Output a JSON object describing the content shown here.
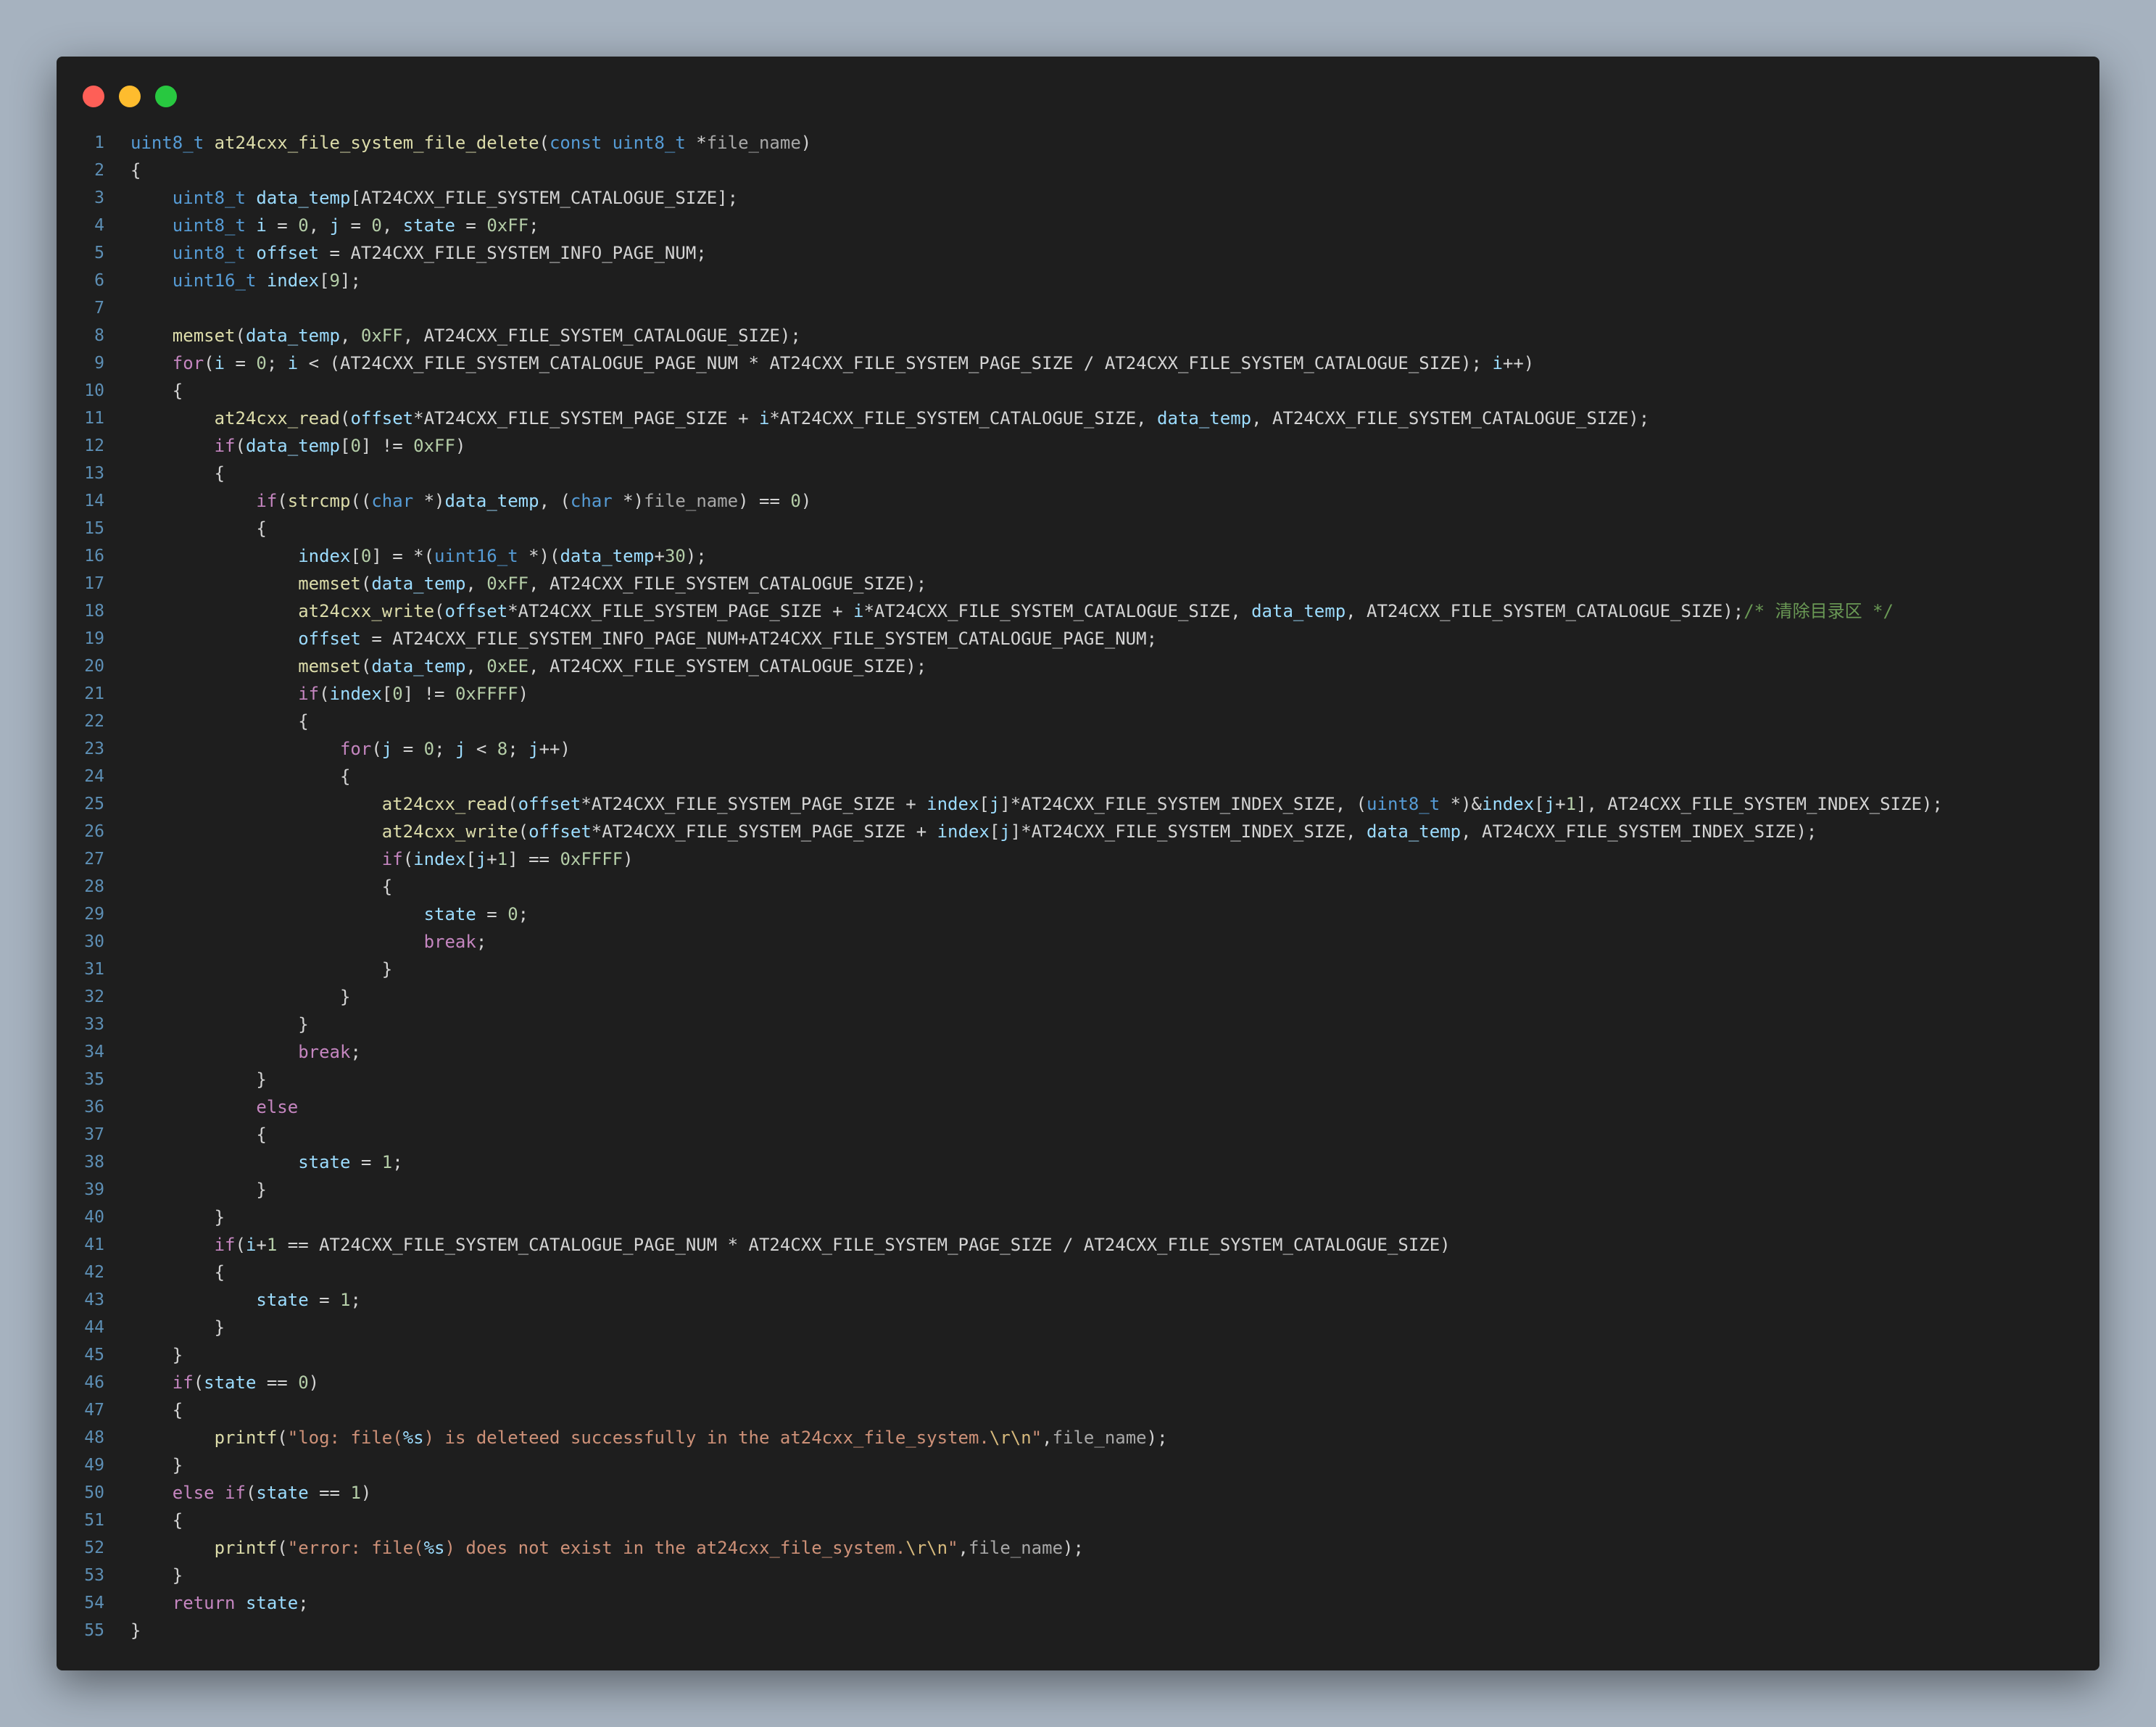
{
  "window": {
    "traffic_lights": [
      {
        "name": "close-button",
        "color": "#fe5f57"
      },
      {
        "name": "minimize-button",
        "color": "#febc2e"
      },
      {
        "name": "maximize-button",
        "color": "#28c840"
      }
    ]
  },
  "code": {
    "language": "c",
    "lines": [
      [
        [
          "type",
          "uint8_t "
        ],
        [
          "fn",
          "at24cxx_file_system_file_delete"
        ],
        [
          "p",
          "("
        ],
        [
          "type",
          "const uint8_t "
        ],
        [
          "p",
          "*"
        ],
        [
          "par",
          "file_name"
        ],
        [
          "p",
          ")"
        ]
      ],
      [
        [
          "p",
          "{"
        ]
      ],
      [
        [
          "p",
          "    "
        ],
        [
          "type",
          "uint8_t "
        ],
        [
          "var",
          "data_temp"
        ],
        [
          "p",
          "[AT24CXX_FILE_SYSTEM_CATALOGUE_SIZE];"
        ]
      ],
      [
        [
          "p",
          "    "
        ],
        [
          "type",
          "uint8_t "
        ],
        [
          "var",
          "i"
        ],
        [
          "p",
          " = "
        ],
        [
          "num",
          "0"
        ],
        [
          "p",
          ", "
        ],
        [
          "var",
          "j"
        ],
        [
          "p",
          " = "
        ],
        [
          "num",
          "0"
        ],
        [
          "p",
          ", "
        ],
        [
          "var",
          "state"
        ],
        [
          "p",
          " = "
        ],
        [
          "num",
          "0xFF"
        ],
        [
          "p",
          ";"
        ]
      ],
      [
        [
          "p",
          "    "
        ],
        [
          "type",
          "uint8_t "
        ],
        [
          "var",
          "offset"
        ],
        [
          "p",
          " = AT24CXX_FILE_SYSTEM_INFO_PAGE_NUM;"
        ]
      ],
      [
        [
          "p",
          "    "
        ],
        [
          "type",
          "uint16_t "
        ],
        [
          "var",
          "index"
        ],
        [
          "p",
          "["
        ],
        [
          "num",
          "9"
        ],
        [
          "p",
          "];"
        ]
      ],
      [],
      [
        [
          "p",
          "    "
        ],
        [
          "fn",
          "memset"
        ],
        [
          "p",
          "("
        ],
        [
          "var",
          "data_temp"
        ],
        [
          "p",
          ", "
        ],
        [
          "num",
          "0xFF"
        ],
        [
          "p",
          ", AT24CXX_FILE_SYSTEM_CATALOGUE_SIZE);"
        ]
      ],
      [
        [
          "p",
          "    "
        ],
        [
          "kw",
          "for"
        ],
        [
          "p",
          "("
        ],
        [
          "var",
          "i"
        ],
        [
          "p",
          " = "
        ],
        [
          "num",
          "0"
        ],
        [
          "p",
          "; "
        ],
        [
          "var",
          "i"
        ],
        [
          "p",
          " < (AT24CXX_FILE_SYSTEM_CATALOGUE_PAGE_NUM * AT24CXX_FILE_SYSTEM_PAGE_SIZE / AT24CXX_FILE_SYSTEM_CATALOGUE_SIZE); "
        ],
        [
          "var",
          "i"
        ],
        [
          "p",
          "++)"
        ]
      ],
      [
        [
          "p",
          "    {"
        ]
      ],
      [
        [
          "p",
          "        "
        ],
        [
          "fn",
          "at24cxx_read"
        ],
        [
          "p",
          "("
        ],
        [
          "var",
          "offset"
        ],
        [
          "p",
          "*AT24CXX_FILE_SYSTEM_PAGE_SIZE + "
        ],
        [
          "var",
          "i"
        ],
        [
          "p",
          "*AT24CXX_FILE_SYSTEM_CATALOGUE_SIZE, "
        ],
        [
          "var",
          "data_temp"
        ],
        [
          "p",
          ", AT24CXX_FILE_SYSTEM_CATALOGUE_SIZE);"
        ]
      ],
      [
        [
          "p",
          "        "
        ],
        [
          "kw",
          "if"
        ],
        [
          "p",
          "("
        ],
        [
          "var",
          "data_temp"
        ],
        [
          "p",
          "["
        ],
        [
          "num",
          "0"
        ],
        [
          "p",
          "] != "
        ],
        [
          "num",
          "0xFF"
        ],
        [
          "p",
          ")"
        ]
      ],
      [
        [
          "p",
          "        {"
        ]
      ],
      [
        [
          "p",
          "            "
        ],
        [
          "kw",
          "if"
        ],
        [
          "p",
          "("
        ],
        [
          "fn",
          "strcmp"
        ],
        [
          "p",
          "(("
        ],
        [
          "type",
          "char "
        ],
        [
          "p",
          "*)"
        ],
        [
          "var",
          "data_temp"
        ],
        [
          "p",
          ", ("
        ],
        [
          "type",
          "char "
        ],
        [
          "p",
          "*)"
        ],
        [
          "par",
          "file_name"
        ],
        [
          "p",
          ") == "
        ],
        [
          "num",
          "0"
        ],
        [
          "p",
          ")"
        ]
      ],
      [
        [
          "p",
          "            {"
        ]
      ],
      [
        [
          "p",
          "                "
        ],
        [
          "var",
          "index"
        ],
        [
          "p",
          "["
        ],
        [
          "num",
          "0"
        ],
        [
          "p",
          "] = *("
        ],
        [
          "type",
          "uint16_t "
        ],
        [
          "p",
          "*)("
        ],
        [
          "var",
          "data_temp"
        ],
        [
          "p",
          "+"
        ],
        [
          "num",
          "30"
        ],
        [
          "p",
          ");"
        ]
      ],
      [
        [
          "p",
          "                "
        ],
        [
          "fn",
          "memset"
        ],
        [
          "p",
          "("
        ],
        [
          "var",
          "data_temp"
        ],
        [
          "p",
          ", "
        ],
        [
          "num",
          "0xFF"
        ],
        [
          "p",
          ", AT24CXX_FILE_SYSTEM_CATALOGUE_SIZE);"
        ]
      ],
      [
        [
          "p",
          "                "
        ],
        [
          "fn",
          "at24cxx_write"
        ],
        [
          "p",
          "("
        ],
        [
          "var",
          "offset"
        ],
        [
          "p",
          "*AT24CXX_FILE_SYSTEM_PAGE_SIZE + "
        ],
        [
          "var",
          "i"
        ],
        [
          "p",
          "*AT24CXX_FILE_SYSTEM_CATALOGUE_SIZE, "
        ],
        [
          "var",
          "data_temp"
        ],
        [
          "p",
          ", AT24CXX_FILE_SYSTEM_CATALOGUE_SIZE);"
        ],
        [
          "com",
          "/* 清除目录区 */"
        ]
      ],
      [
        [
          "p",
          "                "
        ],
        [
          "var",
          "offset"
        ],
        [
          "p",
          " = AT24CXX_FILE_SYSTEM_INFO_PAGE_NUM+AT24CXX_FILE_SYSTEM_CATALOGUE_PAGE_NUM;"
        ]
      ],
      [
        [
          "p",
          "                "
        ],
        [
          "fn",
          "memset"
        ],
        [
          "p",
          "("
        ],
        [
          "var",
          "data_temp"
        ],
        [
          "p",
          ", "
        ],
        [
          "num",
          "0xEE"
        ],
        [
          "p",
          ", AT24CXX_FILE_SYSTEM_CATALOGUE_SIZE);"
        ]
      ],
      [
        [
          "p",
          "                "
        ],
        [
          "kw",
          "if"
        ],
        [
          "p",
          "("
        ],
        [
          "var",
          "index"
        ],
        [
          "p",
          "["
        ],
        [
          "num",
          "0"
        ],
        [
          "p",
          "] != "
        ],
        [
          "num",
          "0xFFFF"
        ],
        [
          "p",
          ")"
        ]
      ],
      [
        [
          "p",
          "                {"
        ]
      ],
      [
        [
          "p",
          "                    "
        ],
        [
          "kw",
          "for"
        ],
        [
          "p",
          "("
        ],
        [
          "var",
          "j"
        ],
        [
          "p",
          " = "
        ],
        [
          "num",
          "0"
        ],
        [
          "p",
          "; "
        ],
        [
          "var",
          "j"
        ],
        [
          "p",
          " < "
        ],
        [
          "num",
          "8"
        ],
        [
          "p",
          "; "
        ],
        [
          "var",
          "j"
        ],
        [
          "p",
          "++)"
        ]
      ],
      [
        [
          "p",
          "                    {"
        ]
      ],
      [
        [
          "p",
          "                        "
        ],
        [
          "fn",
          "at24cxx_read"
        ],
        [
          "p",
          "("
        ],
        [
          "var",
          "offset"
        ],
        [
          "p",
          "*AT24CXX_FILE_SYSTEM_PAGE_SIZE + "
        ],
        [
          "var",
          "index"
        ],
        [
          "p",
          "["
        ],
        [
          "var",
          "j"
        ],
        [
          "p",
          "]*AT24CXX_FILE_SYSTEM_INDEX_SIZE, ("
        ],
        [
          "type",
          "uint8_t "
        ],
        [
          "p",
          "*)&"
        ],
        [
          "var",
          "index"
        ],
        [
          "p",
          "["
        ],
        [
          "var",
          "j"
        ],
        [
          "p",
          "+"
        ],
        [
          "num",
          "1"
        ],
        [
          "p",
          "], AT24CXX_FILE_SYSTEM_INDEX_SIZE);"
        ]
      ],
      [
        [
          "p",
          "                        "
        ],
        [
          "fn",
          "at24cxx_write"
        ],
        [
          "p",
          "("
        ],
        [
          "var",
          "offset"
        ],
        [
          "p",
          "*AT24CXX_FILE_SYSTEM_PAGE_SIZE + "
        ],
        [
          "var",
          "index"
        ],
        [
          "p",
          "["
        ],
        [
          "var",
          "j"
        ],
        [
          "p",
          "]*AT24CXX_FILE_SYSTEM_INDEX_SIZE, "
        ],
        [
          "var",
          "data_temp"
        ],
        [
          "p",
          ", AT24CXX_FILE_SYSTEM_INDEX_SIZE);"
        ]
      ],
      [
        [
          "p",
          "                        "
        ],
        [
          "kw",
          "if"
        ],
        [
          "p",
          "("
        ],
        [
          "var",
          "index"
        ],
        [
          "p",
          "["
        ],
        [
          "var",
          "j"
        ],
        [
          "p",
          "+"
        ],
        [
          "num",
          "1"
        ],
        [
          "p",
          "] == "
        ],
        [
          "num",
          "0xFFFF"
        ],
        [
          "p",
          ")"
        ]
      ],
      [
        [
          "p",
          "                        {"
        ]
      ],
      [
        [
          "p",
          "                            "
        ],
        [
          "var",
          "state"
        ],
        [
          "p",
          " = "
        ],
        [
          "num",
          "0"
        ],
        [
          "p",
          ";"
        ]
      ],
      [
        [
          "p",
          "                            "
        ],
        [
          "kw",
          "break"
        ],
        [
          "p",
          ";"
        ]
      ],
      [
        [
          "p",
          "                        }"
        ]
      ],
      [
        [
          "p",
          "                    }"
        ]
      ],
      [
        [
          "p",
          "                }"
        ]
      ],
      [
        [
          "p",
          "                "
        ],
        [
          "kw",
          "break"
        ],
        [
          "p",
          ";"
        ]
      ],
      [
        [
          "p",
          "            }"
        ]
      ],
      [
        [
          "p",
          "            "
        ],
        [
          "kw",
          "else"
        ]
      ],
      [
        [
          "p",
          "            {"
        ]
      ],
      [
        [
          "p",
          "                "
        ],
        [
          "var",
          "state"
        ],
        [
          "p",
          " = "
        ],
        [
          "num",
          "1"
        ],
        [
          "p",
          ";"
        ]
      ],
      [
        [
          "p",
          "            }"
        ]
      ],
      [
        [
          "p",
          "        }"
        ]
      ],
      [
        [
          "p",
          "        "
        ],
        [
          "kw",
          "if"
        ],
        [
          "p",
          "("
        ],
        [
          "var",
          "i"
        ],
        [
          "p",
          "+"
        ],
        [
          "num",
          "1"
        ],
        [
          "p",
          " == AT24CXX_FILE_SYSTEM_CATALOGUE_PAGE_NUM * AT24CXX_FILE_SYSTEM_PAGE_SIZE / AT24CXX_FILE_SYSTEM_CATALOGUE_SIZE)"
        ]
      ],
      [
        [
          "p",
          "        {"
        ]
      ],
      [
        [
          "p",
          "            "
        ],
        [
          "var",
          "state"
        ],
        [
          "p",
          " = "
        ],
        [
          "num",
          "1"
        ],
        [
          "p",
          ";"
        ]
      ],
      [
        [
          "p",
          "        }"
        ]
      ],
      [
        [
          "p",
          "    }"
        ]
      ],
      [
        [
          "p",
          "    "
        ],
        [
          "kw",
          "if"
        ],
        [
          "p",
          "("
        ],
        [
          "var",
          "state"
        ],
        [
          "p",
          " == "
        ],
        [
          "num",
          "0"
        ],
        [
          "p",
          ")"
        ]
      ],
      [
        [
          "p",
          "    {"
        ]
      ],
      [
        [
          "p",
          "        "
        ],
        [
          "fn",
          "printf"
        ],
        [
          "p",
          "("
        ],
        [
          "str",
          "\"log: file("
        ],
        [
          "var",
          "%s"
        ],
        [
          "str",
          ") is deleteed successfully in the at24cxx_file_system."
        ],
        [
          "esc",
          "\\r\\n"
        ],
        [
          "str",
          "\""
        ],
        [
          "p",
          ","
        ],
        [
          "par",
          "file_name"
        ],
        [
          "p",
          ");"
        ]
      ],
      [
        [
          "p",
          "    }"
        ]
      ],
      [
        [
          "p",
          "    "
        ],
        [
          "kw",
          "else if"
        ],
        [
          "p",
          "("
        ],
        [
          "var",
          "state"
        ],
        [
          "p",
          " == "
        ],
        [
          "num",
          "1"
        ],
        [
          "p",
          ")"
        ]
      ],
      [
        [
          "p",
          "    {"
        ]
      ],
      [
        [
          "p",
          "        "
        ],
        [
          "fn",
          "printf"
        ],
        [
          "p",
          "("
        ],
        [
          "str",
          "\"error: file("
        ],
        [
          "var",
          "%s"
        ],
        [
          "str",
          ") does not exist in the at24cxx_file_system."
        ],
        [
          "esc",
          "\\r\\n"
        ],
        [
          "str",
          "\""
        ],
        [
          "p",
          ","
        ],
        [
          "par",
          "file_name"
        ],
        [
          "p",
          ");"
        ]
      ],
      [
        [
          "p",
          "    }"
        ]
      ],
      [
        [
          "p",
          "    "
        ],
        [
          "kw",
          "return"
        ],
        [
          "p",
          " "
        ],
        [
          "var",
          "state"
        ],
        [
          "p",
          ";"
        ]
      ],
      [
        [
          "p",
          "}"
        ]
      ]
    ]
  }
}
